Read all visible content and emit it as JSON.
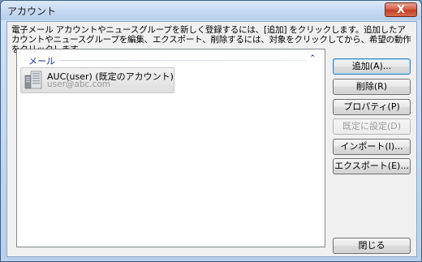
{
  "window": {
    "title": "アカウント",
    "close_symbol": "X"
  },
  "description": "電子メール アカウントやニュースグループを新しく登録するには、[追加] をクリックします。追加したアカウントやニュースグループを編集、エクスポート、削除するには、対象をクリックしてから、希望の動作をクリックします。",
  "list": {
    "group_label": "メール",
    "group_chevron": "⌃",
    "items": [
      {
        "name": "AUC(user) (既定のアカウント)",
        "email": "user@abc.com",
        "icon": "mail-account-icon"
      }
    ]
  },
  "buttons": {
    "add": "追加(A)...",
    "remove": "削除(R)",
    "properties": "プロパティ(P)",
    "set_default": "既定に設定(D)",
    "import": "インポート(I)...",
    "export": "エクスポート(E)...",
    "close": "閉じる"
  },
  "colors": {
    "group_label": "#1e3287",
    "close_button": "#c23f25"
  }
}
